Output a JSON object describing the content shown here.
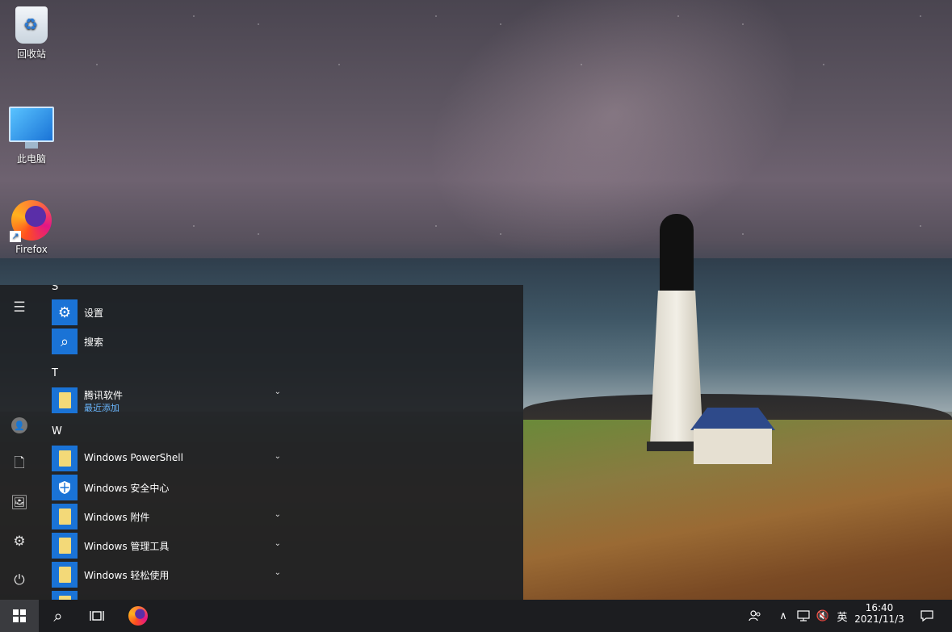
{
  "desktop": {
    "icons": [
      {
        "label": "回收站",
        "icon": "recycle-bin-icon"
      },
      {
        "label": "此电脑",
        "icon": "this-pc-icon"
      },
      {
        "label": "Firefox",
        "icon": "firefox-icon"
      }
    ]
  },
  "start_menu": {
    "rail": {
      "menu_icon": "☰",
      "user_icon": "👤",
      "documents_icon": "🗋",
      "pictures_icon": "🖼",
      "settings_icon": "⚙",
      "power_icon": "⏻"
    },
    "sections": [
      {
        "letter": "S"
      },
      {
        "letter": "T"
      },
      {
        "letter": "W"
      }
    ],
    "apps": [
      {
        "name": "设置",
        "icon": "gear-icon"
      },
      {
        "name": "搜索",
        "icon": "search-icon"
      },
      {
        "name": "腾讯软件",
        "sub": "最近添加",
        "icon": "folder-icon"
      },
      {
        "name": "Windows PowerShell",
        "icon": "folder-icon"
      },
      {
        "name": "Windows 安全中心",
        "icon": "shield-icon"
      },
      {
        "name": "Windows 附件",
        "icon": "folder-icon"
      },
      {
        "name": "Windows 管理工具",
        "icon": "folder-icon"
      },
      {
        "name": "Windows 轻松使用",
        "icon": "folder-icon"
      }
    ],
    "chevron": "⌄"
  },
  "taskbar": {
    "search_icon": "⌕",
    "task_view_icon": "task-view-icon",
    "tray": {
      "people_icon": "people-icon",
      "chevron_up": "∧",
      "network_icon": "network-icon",
      "volume_icon": "🔇",
      "ime": "英",
      "time": "16:40",
      "date": "2021/11/3",
      "notification_icon": "notification-icon"
    }
  }
}
